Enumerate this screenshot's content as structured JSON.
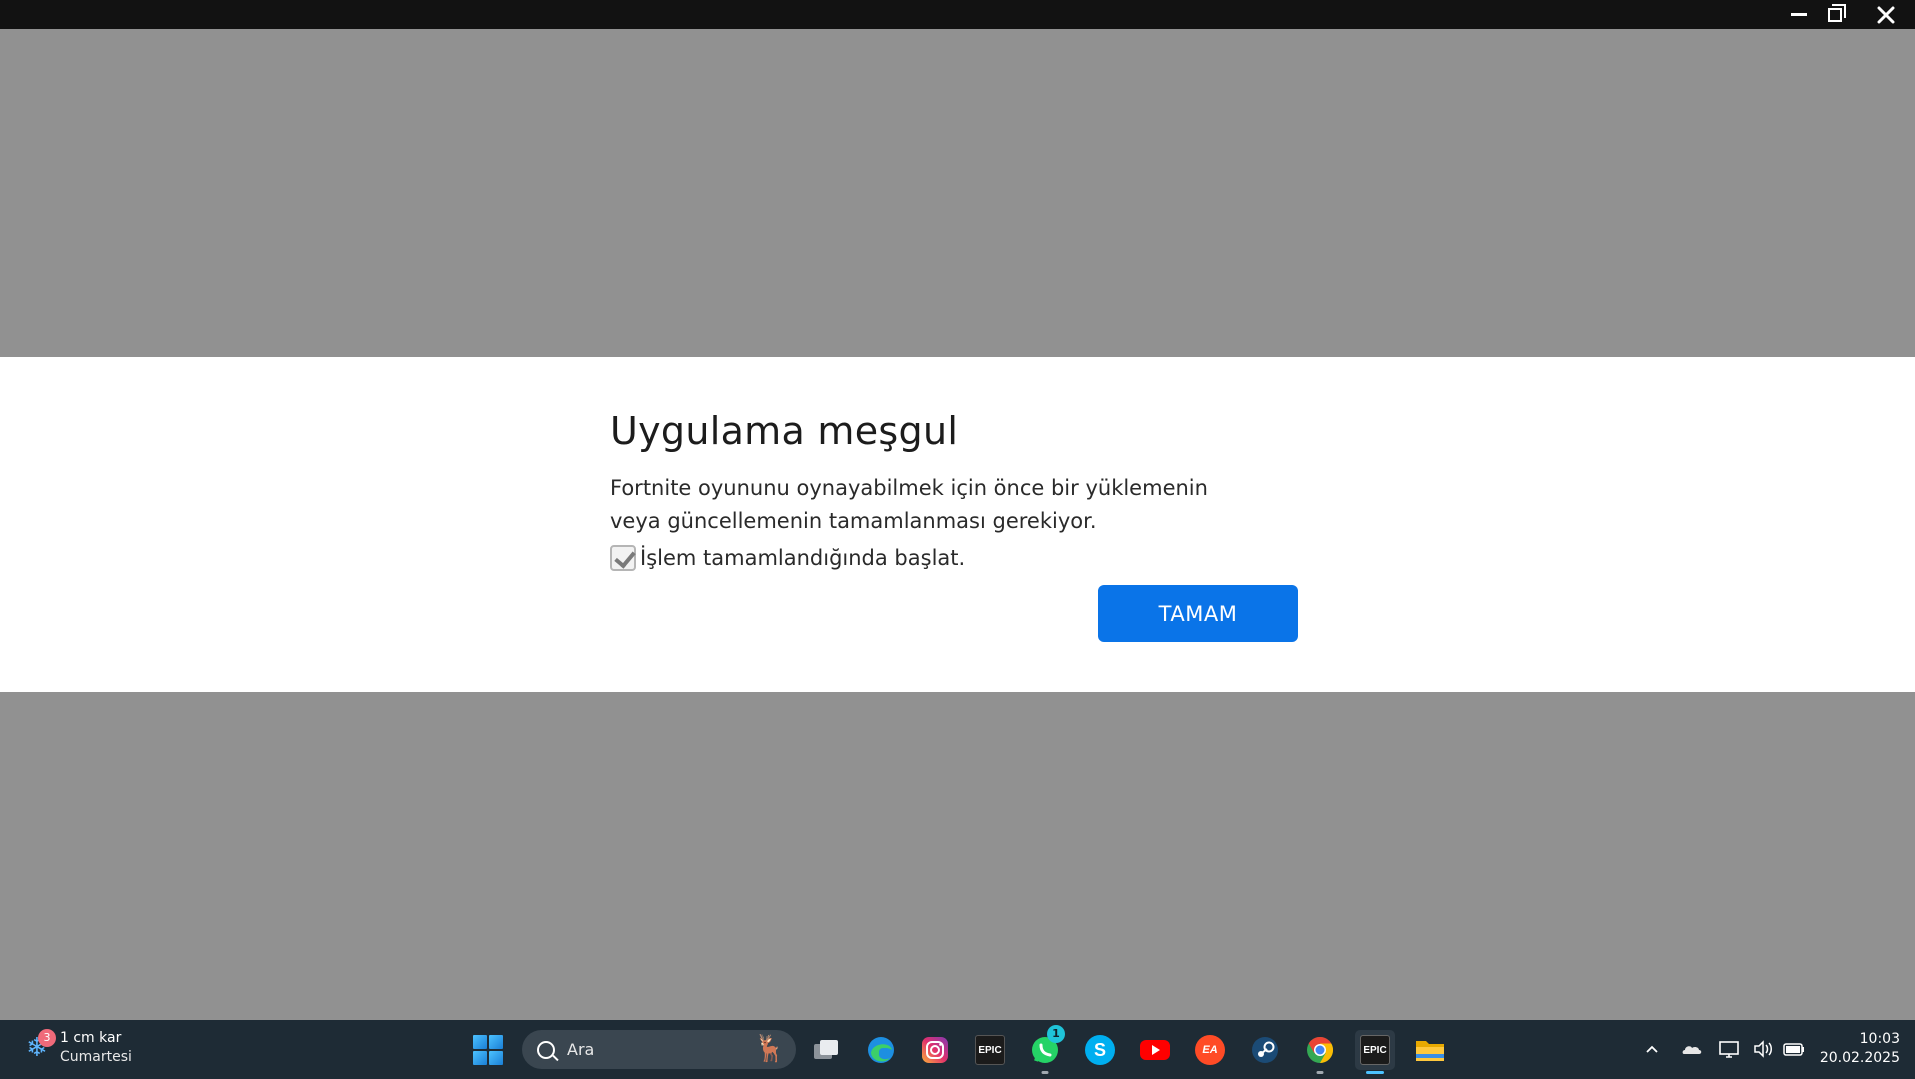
{
  "window": {
    "minimize_icon": "minimize-icon",
    "maximize_icon": "restore-icon",
    "close_icon": "close-icon"
  },
  "dialog": {
    "title": "Uygulama meşgul",
    "message": "Fortnite oyununu oynayabilmek için önce bir yüklemenin veya güncellemenin tamamlanması gerekiyor.",
    "checkbox_label": "İşlem tamamlandığında başlat.",
    "checkbox_checked": true,
    "ok_label": "TAMAM",
    "accent_color": "#0a74e8"
  },
  "taskbar": {
    "weather": {
      "badge": "3",
      "line1": "1 cm kar",
      "line2": "Cumartesi",
      "icon": "snowflake-icon"
    },
    "search": {
      "placeholder": "Ara"
    },
    "apps": [
      {
        "name": "task-view",
        "icon": "task-view-icon"
      },
      {
        "name": "edge",
        "icon": "edge-icon"
      },
      {
        "name": "instagram",
        "icon": "instagram-icon"
      },
      {
        "name": "epic-games",
        "icon": "epic-games-icon",
        "label": "EPIC"
      },
      {
        "name": "whatsapp",
        "icon": "whatsapp-icon",
        "badge": "1"
      },
      {
        "name": "skype",
        "icon": "skype-icon",
        "label": "S"
      },
      {
        "name": "youtube",
        "icon": "youtube-icon"
      },
      {
        "name": "ea",
        "icon": "ea-icon",
        "label": "EA"
      },
      {
        "name": "steam",
        "icon": "steam-icon"
      },
      {
        "name": "chrome",
        "icon": "chrome-icon"
      },
      {
        "name": "epic-games-active",
        "icon": "epic-games-icon",
        "label": "EPIC"
      },
      {
        "name": "file-explorer",
        "icon": "folder-icon"
      }
    ],
    "tray": [
      "chevron-up-icon",
      "onedrive-icon",
      "network-icon",
      "volume-icon",
      "battery-icon"
    ],
    "clock": {
      "time": "10:03",
      "date": "20.02.2025"
    }
  }
}
